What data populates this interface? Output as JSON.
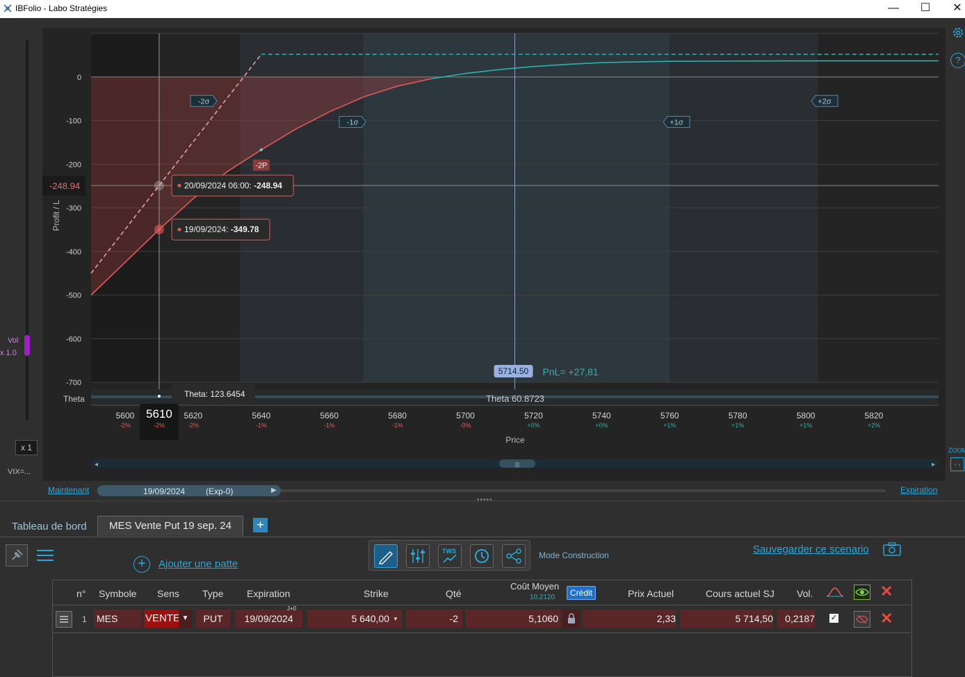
{
  "window": {
    "title": "IBFolio - Labo Stratégies",
    "controls": {
      "minimize": "—",
      "maximize": "☐",
      "close": "✕"
    }
  },
  "left_rail": {
    "vol_label": "Vol",
    "vol_multiplier": "x 1.0",
    "vol_level_fraction": 0.78,
    "scale_button": "x 1",
    "vix": "VIX=..."
  },
  "right_rail": {
    "help": "?",
    "zoom": "ZOOM",
    "zoom_icon": "‹ ›"
  },
  "chart_data": {
    "type": "line",
    "ylabel": "Profit / L",
    "xlabel": "Price",
    "x_ticks": [
      {
        "v": 5600,
        "p": "-2%"
      },
      {
        "v": 5620,
        "p": "-2%"
      },
      {
        "v": 5640,
        "p": "-1%"
      },
      {
        "v": 5660,
        "p": "-1%"
      },
      {
        "v": 5680,
        "p": "-1%"
      },
      {
        "v": 5700,
        "p": "-0%"
      },
      {
        "v": 5720,
        "p": "+0%"
      },
      {
        "v": 5740,
        "p": "+0%"
      },
      {
        "v": 5760,
        "p": "+1%"
      },
      {
        "v": 5780,
        "p": "+1%"
      },
      {
        "v": 5800,
        "p": "+1%"
      },
      {
        "v": 5820,
        "p": "+2%"
      }
    ],
    "y_ticks": [
      0,
      -100,
      -200,
      -300,
      -400,
      -500,
      -600,
      -700
    ],
    "xlim": [
      5590,
      5839
    ],
    "ylim": [
      -700,
      100
    ],
    "series": [
      {
        "name": "19/09/2024",
        "style": "solid",
        "points": [
          [
            5590,
            -500
          ],
          [
            5610,
            -349.78
          ],
          [
            5620,
            -279
          ],
          [
            5630,
            -217
          ],
          [
            5640,
            -167
          ],
          [
            5650,
            -120
          ],
          [
            5660,
            -80
          ],
          [
            5670,
            -46
          ],
          [
            5680,
            -21
          ],
          [
            5690,
            -4
          ],
          [
            5700,
            8
          ],
          [
            5710,
            17
          ],
          [
            5720,
            24
          ],
          [
            5730,
            29
          ],
          [
            5740,
            33
          ],
          [
            5760,
            36
          ],
          [
            5800,
            37
          ],
          [
            5839,
            37
          ]
        ]
      },
      {
        "name": "Expiration",
        "style": "dashed",
        "points": [
          [
            5590,
            -450
          ],
          [
            5610,
            -248.94
          ],
          [
            5640,
            52
          ],
          [
            5839,
            52
          ]
        ]
      }
    ],
    "cursor": {
      "x": 5610,
      "x_label": "5610",
      "x_pct": "-2%",
      "y_label": "-248.94",
      "tooltip_exp": "20/09/2024 06:00: -248.94",
      "tooltip_exp_date": "20/09/2024 06:00: ",
      "tooltip_exp_value": "-248.94",
      "tooltip_now_date": "19/09/2024: ",
      "tooltip_now_value": "-349.78",
      "theta_tooltip_label": "Theta: ",
      "theta_tooltip_value": "123.6454"
    },
    "current_price": {
      "x": 5714.5,
      "label": "5714.50",
      "pnl": "PnL= +27,81"
    },
    "sigma_bands": [
      {
        "label": "-2σ",
        "x": 5597
      },
      {
        "label": "-1σ",
        "x": 5641
      },
      {
        "label": "+1σ",
        "x": 5758
      },
      {
        "label": "+2σ",
        "x": 5802
      }
    ],
    "strike_marker": {
      "label": "-2P",
      "x": 5640,
      "y": -167
    },
    "theta": {
      "label": "Theta",
      "value_label": "Theta 60.8723"
    },
    "colors": {
      "loss": "#e05b5b",
      "profit": "#2ab3b3",
      "band": "#3a4248"
    }
  },
  "timeline": {
    "now_label": "Maintenant",
    "date": "19/09/2024",
    "exp_tag": "(Exp-0)",
    "expiration_label": "Expiration"
  },
  "tabs": [
    {
      "label": "Tableau de bord",
      "active": false
    },
    {
      "label": "MES Vente Put 19 sep. 24",
      "active": true
    }
  ],
  "toolbar": {
    "add_leg": "Ajouter une patte",
    "mode": "Mode Construction",
    "save": "Sauvegarder ce scenario",
    "tws": "TWS"
  },
  "grid": {
    "headers": {
      "n": "n°",
      "symbol": "Symbole",
      "side": "Sens",
      "type": "Type",
      "expiration": "Expiration",
      "strike": "Strike",
      "qty": "Qté",
      "avg_cost": "Coût Moyen",
      "avg_cost_value": "10,2120",
      "credit": "Crédit",
      "price": "Prix Actuel",
      "underlying": "Cours actuel SJ",
      "vol": "Vol."
    },
    "rows": [
      {
        "n": "1",
        "symbol": "MES",
        "side": "VENTE",
        "type": "PUT",
        "expiration": "19/09/2024",
        "exp_tag": "J+0",
        "strike": "5 640,00",
        "qty": "-2",
        "avg_cost": "5,1060",
        "price": "2,33",
        "underlying": "5 714,50",
        "vol": "0,2187"
      }
    ]
  }
}
